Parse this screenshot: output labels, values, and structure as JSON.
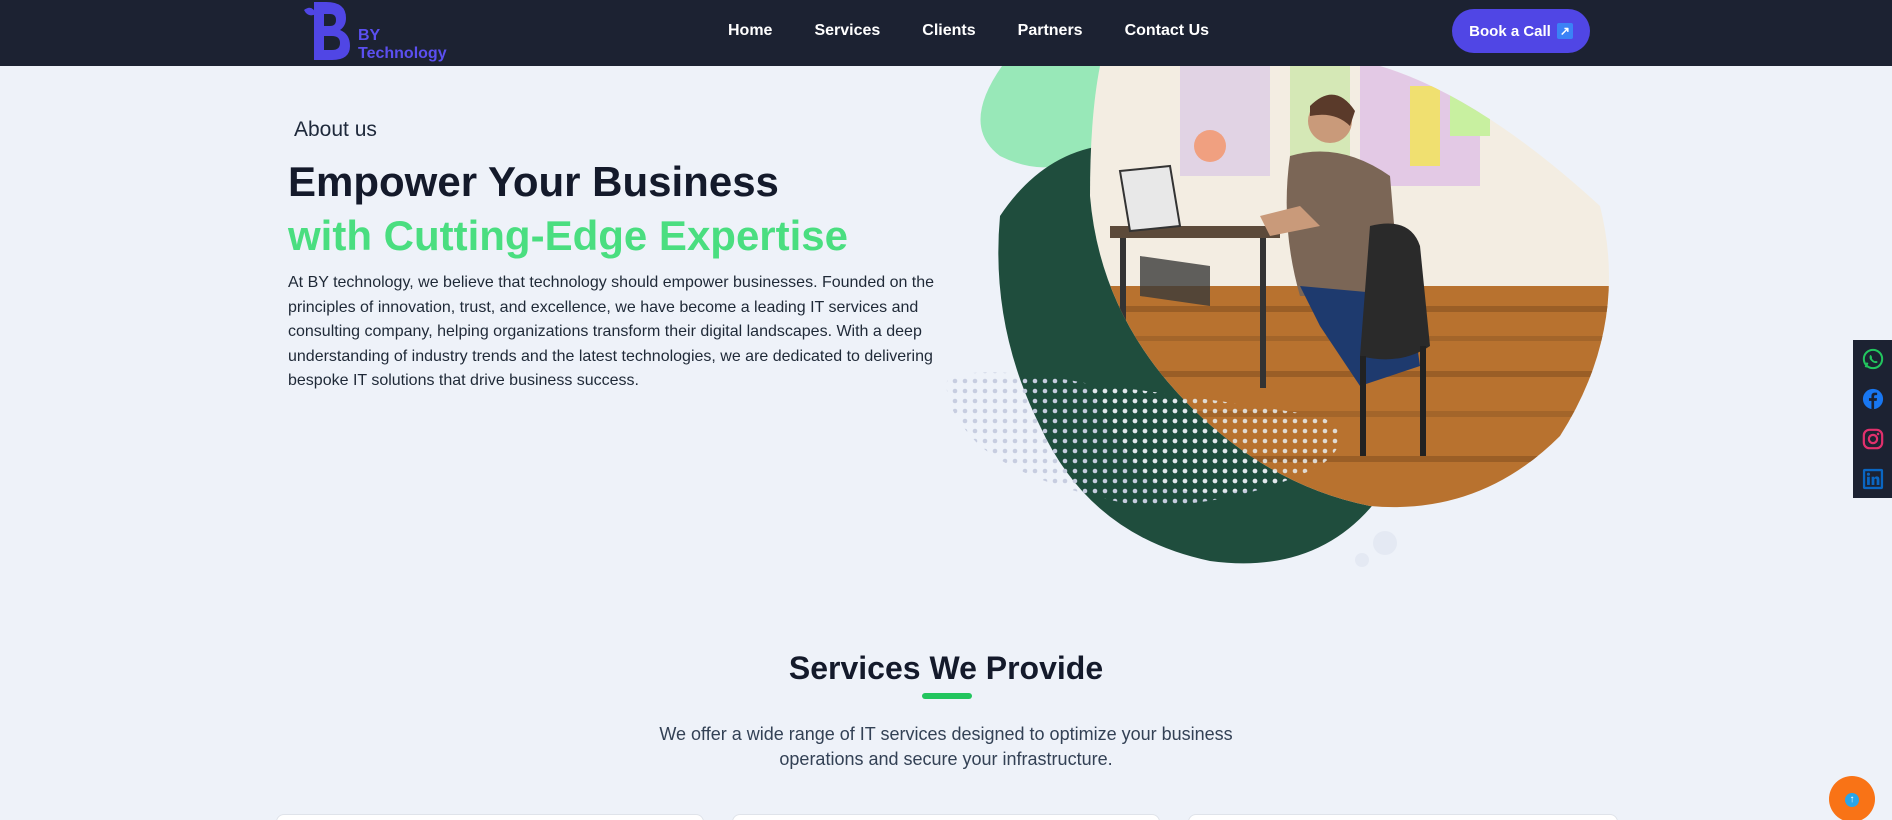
{
  "nav": {
    "logo_by": "BY",
    "logo_technology": "Technology",
    "links": [
      "Home",
      "Services",
      "Clients",
      "Partners",
      "Contact Us"
    ],
    "cta_label": "Book a Call",
    "cta_icon": "external-link-icon"
  },
  "hero": {
    "eyebrow": "About us",
    "title_line1": "Empower Your Business",
    "title_line2": "with Cutting-Edge Expertise",
    "paragraph": "At BY technology, we believe that technology should empower businesses. Founded on the principles of innovation, trust, and excellence, we have become a leading IT services and consulting company, helping organizations transform their digital landscapes. With a deep understanding of industry trends and the latest technologies, we are dedicated to delivering bespoke IT solutions that drive business success."
  },
  "services": {
    "title": "Services We Provide",
    "subtitle": "We offer a wide range of IT services designed to optimize your business operations and secure your infrastructure."
  },
  "socials": [
    "whatsapp-icon",
    "facebook-icon",
    "instagram-icon",
    "linkedin-icon"
  ],
  "colors": {
    "nav_bg": "#1c2232",
    "brand": "#5046e5",
    "accent_green": "#4ade80",
    "page_bg": "#eef2f9",
    "dark_green": "#1f4d3d",
    "scroll_top": "#f97316"
  }
}
